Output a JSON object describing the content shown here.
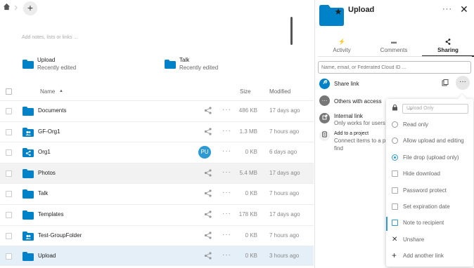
{
  "breadcrumb": {
    "home_icon": "home-icon",
    "new_button": "+"
  },
  "notes_placeholder": "Add notes, lists or links ...",
  "recent": [
    {
      "name": "Upload",
      "sub": "Recently edited"
    },
    {
      "name": "Talk",
      "sub": "Recently edited"
    }
  ],
  "table": {
    "headers": {
      "name": "Name",
      "sort": "▲",
      "size": "Size",
      "modified": "Modified"
    },
    "rows": [
      {
        "name": "Documents",
        "size": "486 KB",
        "modified": "17 days ago",
        "icon": "folder",
        "shared": false
      },
      {
        "name": "GF-Org1",
        "size": "1.3 MB",
        "modified": "7 hours ago",
        "icon": "group-folder",
        "shared": false
      },
      {
        "name": "Org1",
        "size": "0 KB",
        "modified": "6 days ago",
        "icon": "shared-folder",
        "shared": true,
        "avatar": "PU"
      },
      {
        "name": "Photos",
        "size": "5.4 MB",
        "modified": "17 days ago",
        "icon": "folder",
        "shared": false
      },
      {
        "name": "Talk",
        "size": "0 KB",
        "modified": "7 hours ago",
        "icon": "folder",
        "shared": false
      },
      {
        "name": "Templates",
        "size": "178 KB",
        "modified": "17 days ago",
        "icon": "folder",
        "shared": false
      },
      {
        "name": "Test-GroupFolder",
        "size": "0 KB",
        "modified": "7 hours ago",
        "icon": "group-folder",
        "shared": false
      },
      {
        "name": "Upload",
        "size": "0 KB",
        "modified": "3 hours ago",
        "icon": "folder",
        "shared": false
      }
    ]
  },
  "sidebar": {
    "title": "Upload",
    "more": "···",
    "close": "✕",
    "tabs": [
      {
        "label": "Activity",
        "icon": "⚡"
      },
      {
        "label": "Comments",
        "icon": "▬"
      },
      {
        "label": "Sharing",
        "icon": "<"
      }
    ],
    "search_placeholder": "Name, email, or Federated Cloud ID ...",
    "share_link": "Share link",
    "others_access": "Others with access",
    "internal_link": "Internal link",
    "internal_sub": "Only works for users w",
    "add_project": "Add to a project",
    "add_project_sub1": "Connect items to a p",
    "add_project_sub2": "find"
  },
  "menu": {
    "password_placeholder": "Upload Only",
    "items": [
      {
        "label": "Read only",
        "kind": "radio",
        "checked": false
      },
      {
        "label": "Allow upload and editing",
        "kind": "radio",
        "checked": false
      },
      {
        "label": "File drop (upload only)",
        "kind": "radio",
        "checked": true
      },
      {
        "label": "Hide download",
        "kind": "checkbox",
        "checked": false
      },
      {
        "label": "Password protect",
        "kind": "checkbox",
        "checked": false
      },
      {
        "label": "Set expiration date",
        "kind": "checkbox",
        "checked": false
      },
      {
        "label": "Note to recipient",
        "kind": "checkbox",
        "checked": false
      },
      {
        "label": "Unshare",
        "kind": "action"
      },
      {
        "label": "Add another link",
        "kind": "action"
      }
    ]
  },
  "colors": {
    "accent": "#2d9ad4",
    "folder": "#0082c9"
  }
}
